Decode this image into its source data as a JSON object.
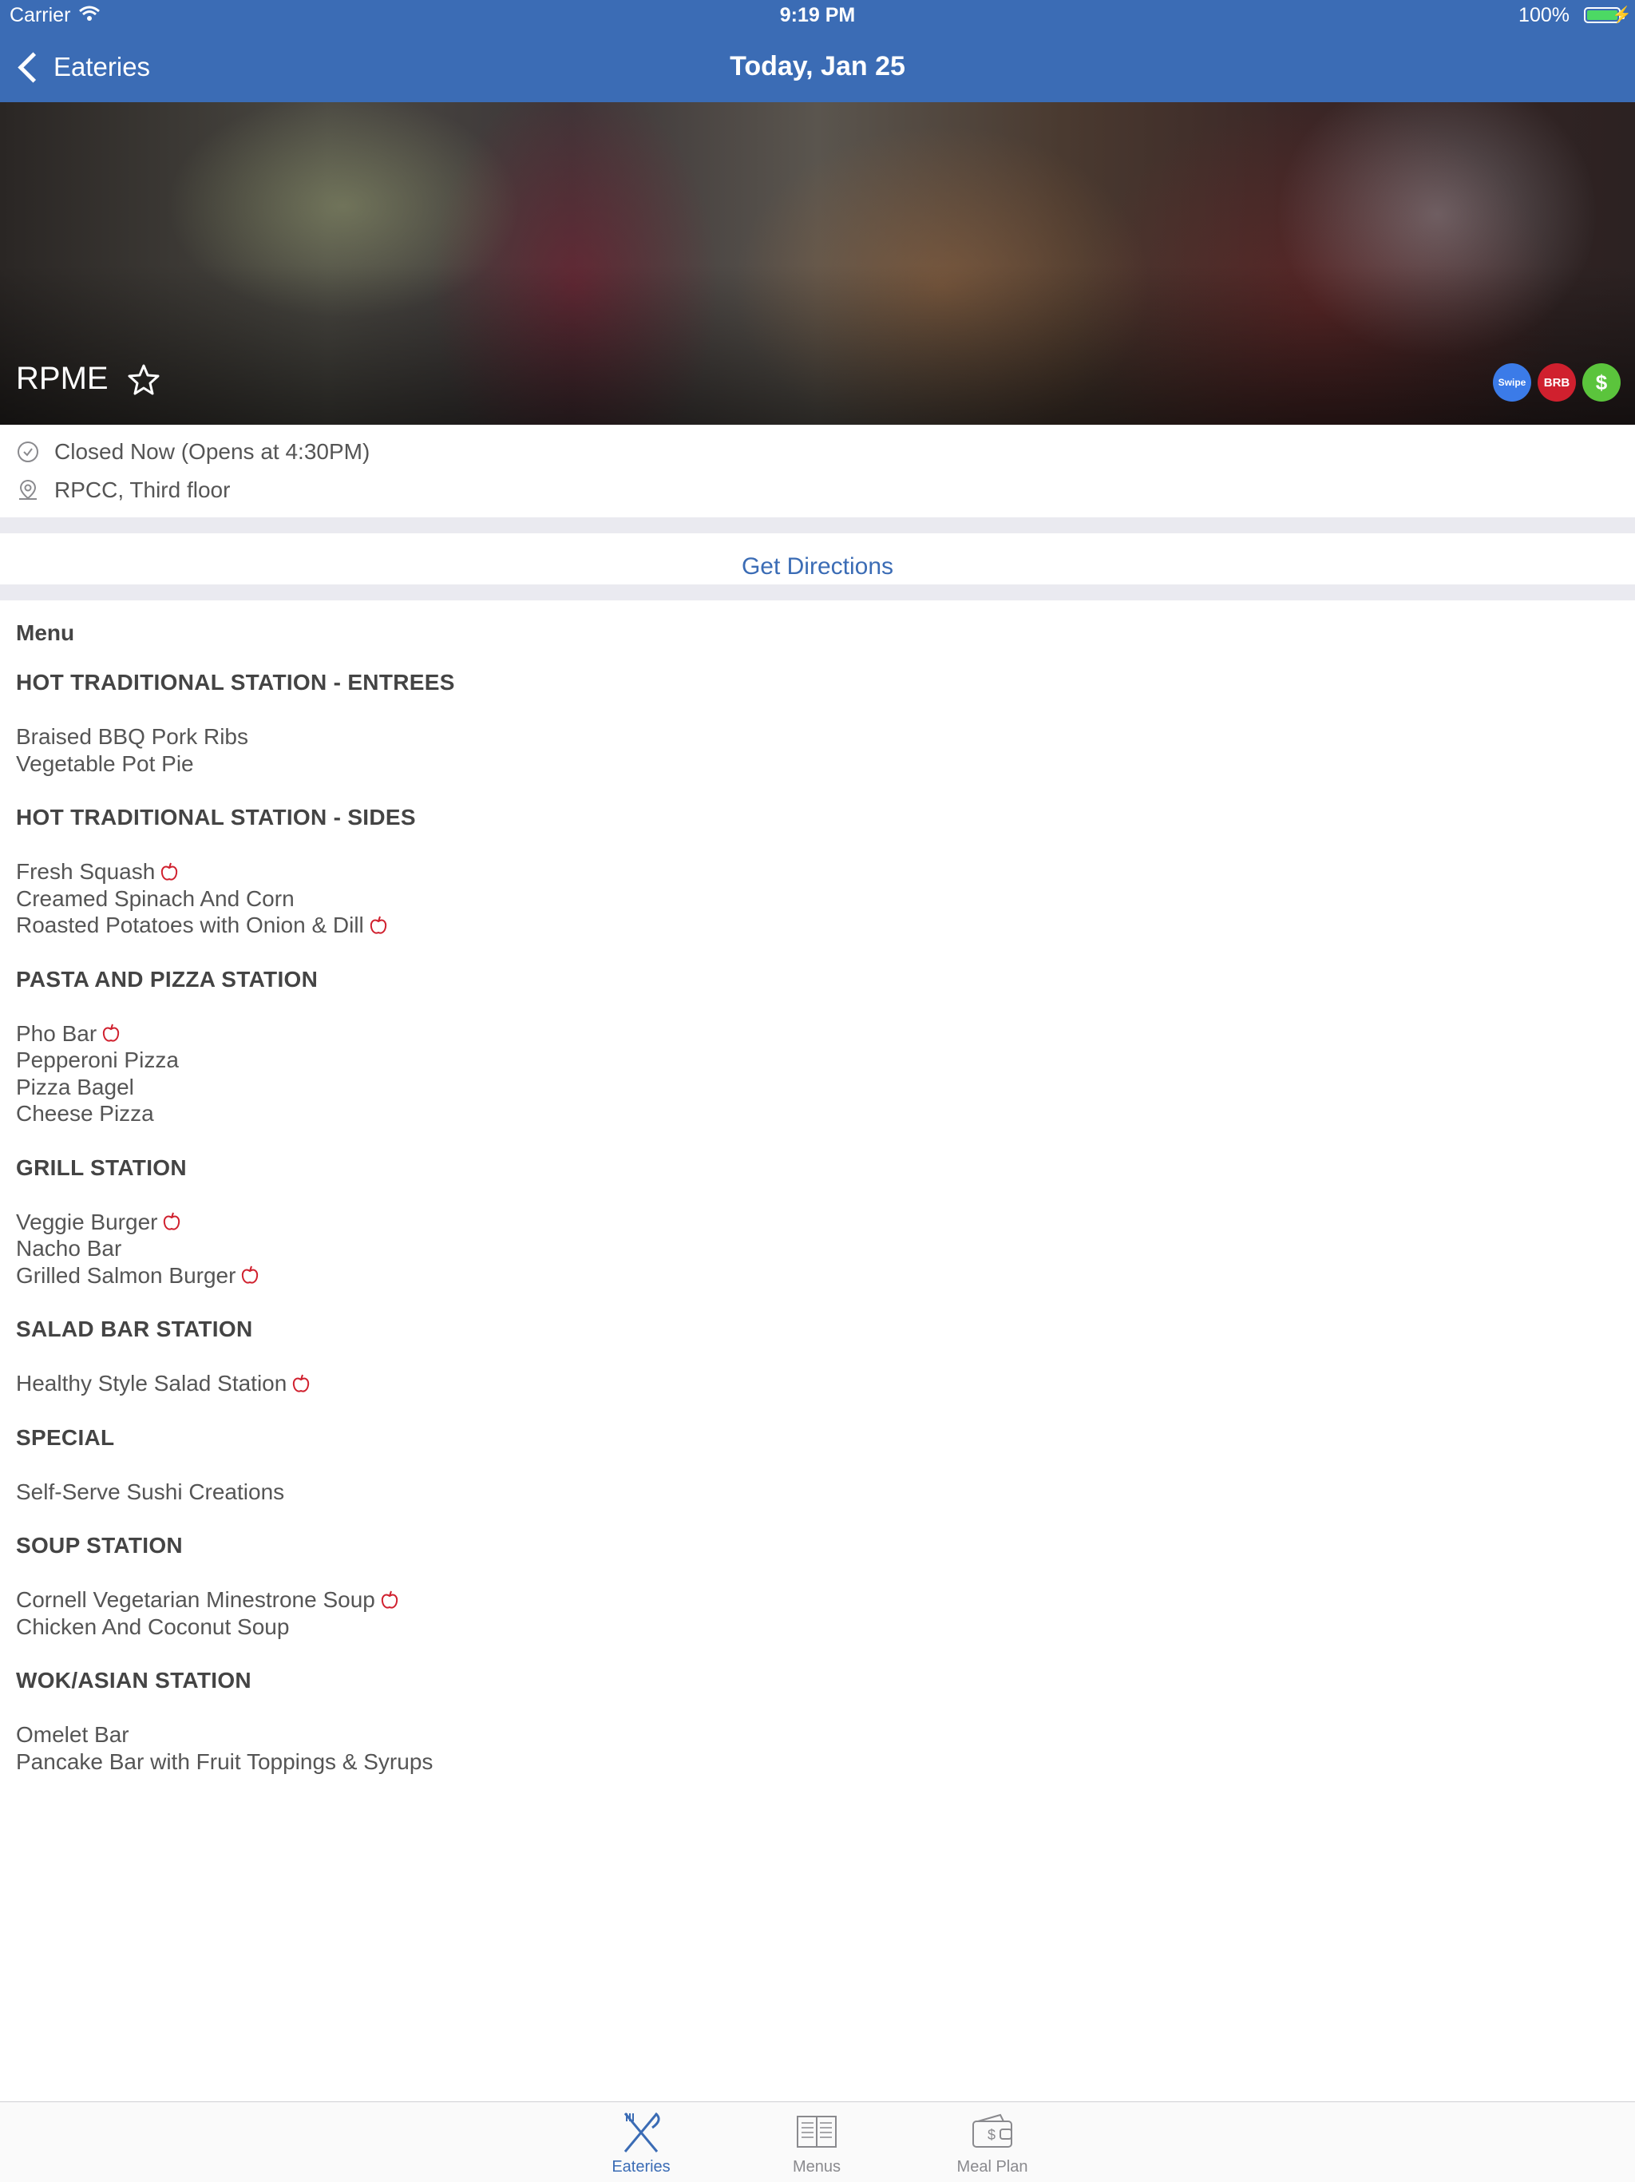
{
  "status_bar": {
    "carrier": "Carrier",
    "time": "9:19 PM",
    "battery": "100%"
  },
  "nav": {
    "back_label": "Eateries",
    "title": "Today, Jan 25"
  },
  "eatery": {
    "name": "RPME",
    "badges": [
      {
        "label": "Swipe",
        "color": "#3b7be8"
      },
      {
        "label": "BRB",
        "color": "#d0202e"
      },
      {
        "label": "$",
        "color": "#5bc43c"
      }
    ],
    "status": "Closed Now (Opens at 4:30PM)",
    "location": "RPCC, Third floor",
    "directions_label": "Get Directions"
  },
  "menu": {
    "title": "Menu",
    "stations": [
      {
        "name": "HOT TRADITIONAL STATION - ENTREES",
        "items": [
          {
            "name": "Braised BBQ Pork Ribs",
            "healthy": false
          },
          {
            "name": "Vegetable Pot Pie",
            "healthy": false
          }
        ]
      },
      {
        "name": "HOT TRADITIONAL STATION - SIDES",
        "items": [
          {
            "name": "Fresh Squash",
            "healthy": true
          },
          {
            "name": "Creamed Spinach And Corn",
            "healthy": false
          },
          {
            "name": "Roasted Potatoes with Onion & Dill",
            "healthy": true
          }
        ]
      },
      {
        "name": "PASTA AND PIZZA STATION",
        "items": [
          {
            "name": "Pho Bar",
            "healthy": true
          },
          {
            "name": "Pepperoni Pizza",
            "healthy": false
          },
          {
            "name": "Pizza Bagel",
            "healthy": false
          },
          {
            "name": "Cheese Pizza",
            "healthy": false
          }
        ]
      },
      {
        "name": "GRILL STATION",
        "items": [
          {
            "name": "Veggie Burger",
            "healthy": true
          },
          {
            "name": "Nacho Bar",
            "healthy": false
          },
          {
            "name": "Grilled Salmon Burger",
            "healthy": true
          }
        ]
      },
      {
        "name": "SALAD BAR STATION",
        "items": [
          {
            "name": "Healthy Style Salad Station",
            "healthy": true
          }
        ]
      },
      {
        "name": "SPECIAL",
        "items": [
          {
            "name": "Self-Serve Sushi Creations",
            "healthy": false
          }
        ]
      },
      {
        "name": "SOUP STATION",
        "items": [
          {
            "name": "Cornell Vegetarian Minestrone Soup",
            "healthy": true
          },
          {
            "name": "Chicken And Coconut Soup",
            "healthy": false
          }
        ]
      },
      {
        "name": "WOK/ASIAN STATION",
        "items": [
          {
            "name": "Omelet Bar",
            "healthy": false
          },
          {
            "name": "Pancake Bar with Fruit Toppings & Syrups",
            "healthy": false
          }
        ]
      }
    ]
  },
  "tabs": [
    {
      "label": "Eateries",
      "icon": "fork-knife-icon",
      "active": true
    },
    {
      "label": "Menus",
      "icon": "menu-book-icon",
      "active": false
    },
    {
      "label": "Meal Plan",
      "icon": "wallet-icon",
      "active": false
    }
  ],
  "colors": {
    "accent": "#3b6cb5",
    "healthy_icon": "#d0202e"
  }
}
